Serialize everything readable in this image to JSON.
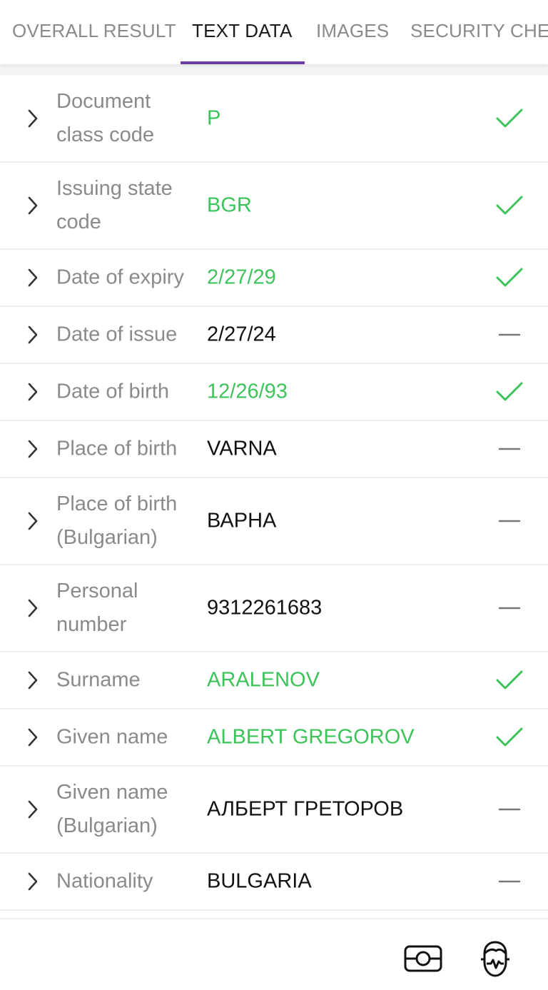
{
  "tabs": [
    {
      "label": "OVERALL RESULT",
      "active": false
    },
    {
      "label": "TEXT DATA",
      "active": true
    },
    {
      "label": "IMAGES",
      "active": false
    },
    {
      "label": "SECURITY CHECKS",
      "active": false
    }
  ],
  "colors": {
    "accent": "#6b3fa0",
    "valid": "#3cc35a",
    "muted": "#8a8a8e",
    "divider": "#ececee"
  },
  "fields": [
    {
      "label": "Document class code",
      "value": "P",
      "status": "valid"
    },
    {
      "label": "Issuing state code",
      "value": "BGR",
      "status": "valid"
    },
    {
      "label": "Date of expiry",
      "value": "2/27/29",
      "status": "valid"
    },
    {
      "label": "Date of issue",
      "value": "2/27/24",
      "status": "none"
    },
    {
      "label": "Date of birth",
      "value": "12/26/93",
      "status": "valid"
    },
    {
      "label": "Place of birth",
      "value": "VARNA",
      "status": "none"
    },
    {
      "label": "Place of birth (Bulgarian)",
      "value": "ВАРНА",
      "status": "none"
    },
    {
      "label": "Personal number",
      "value": "9312261683",
      "status": "none"
    },
    {
      "label": "Surname",
      "value": "ARALENOV",
      "status": "valid"
    },
    {
      "label": "Given name",
      "value": "ALBERT GREGOROV",
      "status": "valid"
    },
    {
      "label": "Given name (Bulgarian)",
      "value": "АЛБЕРТ ГРЕТОРОВ",
      "status": "none"
    },
    {
      "label": "Nationality",
      "value": "BULGARIA",
      "status": "none"
    }
  ],
  "bottom_icons": [
    "document-scan-icon",
    "face-liveness-icon"
  ]
}
